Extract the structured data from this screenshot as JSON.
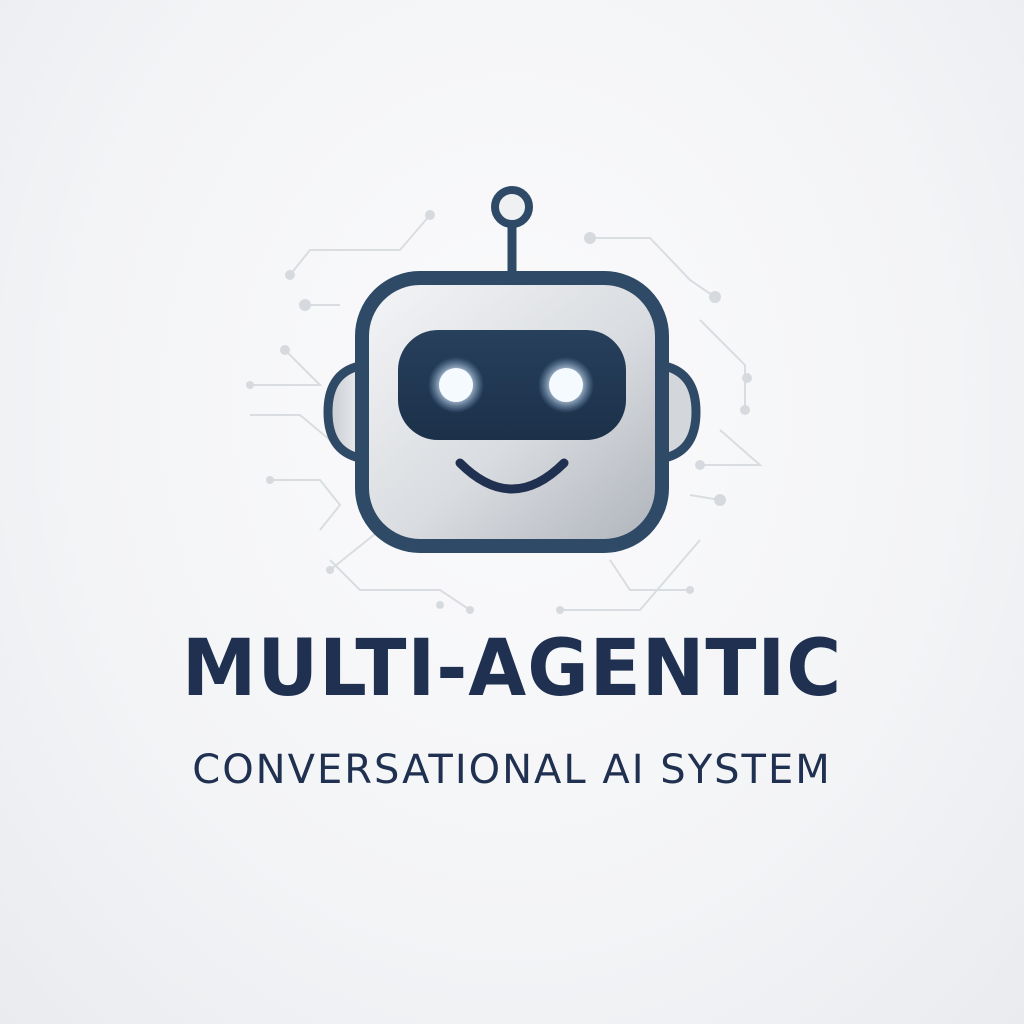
{
  "logo": {
    "title": "MULTI-AGENTIC",
    "subtitle": "CONVERSATIONAL AI SYSTEM",
    "icon": "robot-head-icon"
  },
  "colors": {
    "navy": "#1f3050",
    "outline": "#2f4a66",
    "face_light": "#eceef1",
    "face_dark": "#b8bdc4",
    "eye_glow": "#e8f4ff",
    "circuit": "#d4d8dd"
  }
}
